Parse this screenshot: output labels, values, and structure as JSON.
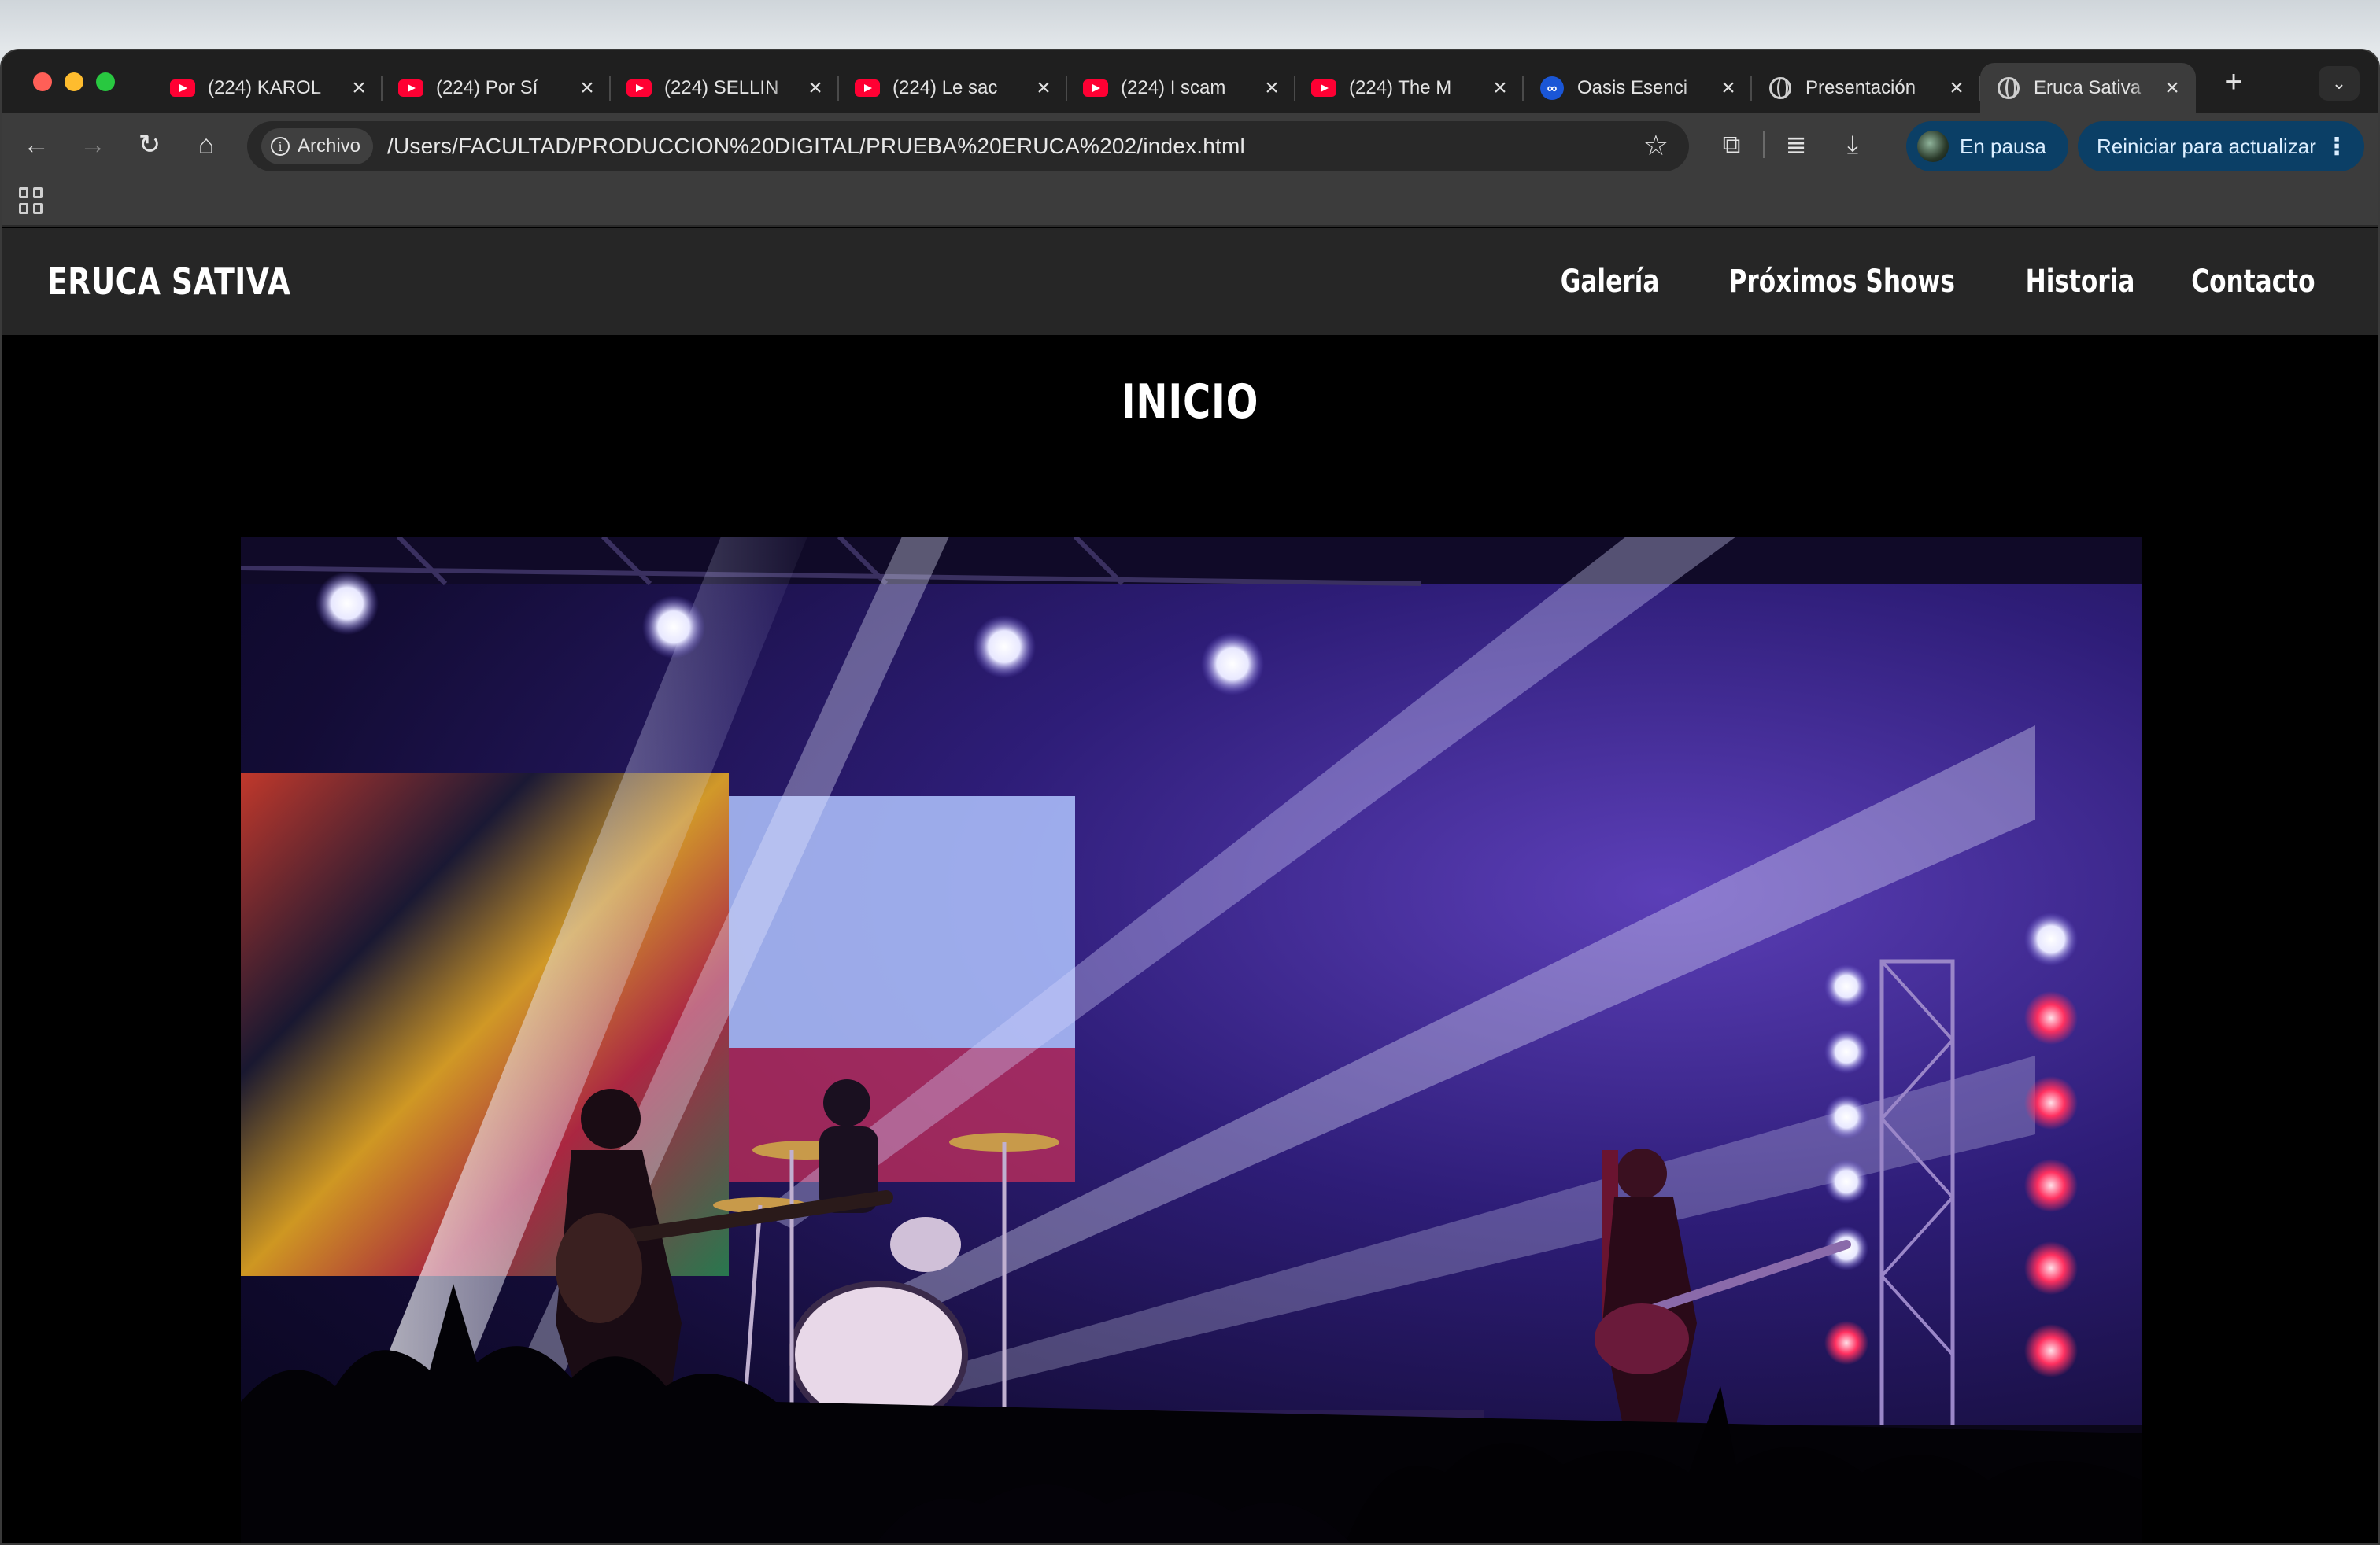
{
  "browser": {
    "tabs": [
      {
        "icon": "youtube-icon",
        "title": "(224) KAROL"
      },
      {
        "icon": "youtube-icon",
        "title": "(224) Por Sí"
      },
      {
        "icon": "youtube-icon",
        "title": "(224) SELLIN"
      },
      {
        "icon": "youtube-icon",
        "title": "(224) Le sac"
      },
      {
        "icon": "youtube-icon",
        "title": "(224) I scam"
      },
      {
        "icon": "youtube-icon",
        "title": "(224) The M"
      },
      {
        "icon": "oasis-icon",
        "title": "Oasis Esenci"
      },
      {
        "icon": "globe-icon",
        "title": "Presentación"
      },
      {
        "icon": "globe-icon",
        "title": "Eruca Sativa",
        "active": true
      }
    ],
    "close_glyph": "×",
    "new_tab_glyph": "+",
    "omnibox": {
      "chip_label": "Archivo",
      "url": "/Users/FACULTAD/PRODUCCION%20DIGITAL/PRUEBA%20ERUCA%202/index.html"
    },
    "profile_label": "En pausa",
    "update_label": "Reiniciar para actualizar",
    "colors": {
      "tabstrip": "#1f1f1f",
      "toolbar": "#3c3c3c",
      "accent_button": "#0b3f66"
    }
  },
  "site": {
    "brand": "ERUCA SATIVA",
    "nav": [
      "Galería",
      "Próximos Shows",
      "Historia",
      "Contacto"
    ],
    "section_title": "INICIO",
    "header_bg": "#262626"
  }
}
